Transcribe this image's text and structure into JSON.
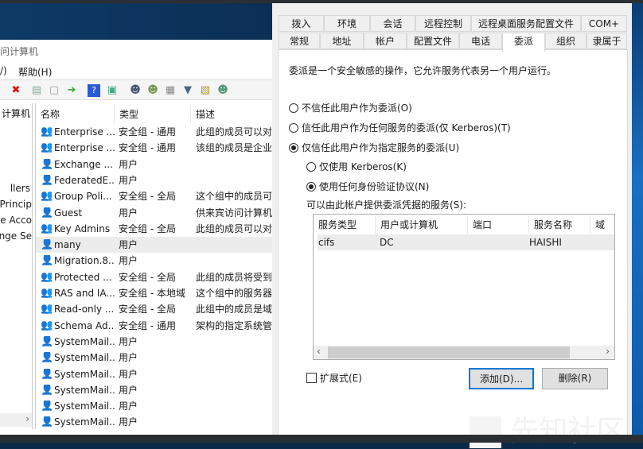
{
  "left_window": {
    "title": "问计算机",
    "menu": [
      "/)",
      "帮助(H)"
    ],
    "toolbar_icons": [
      "delete-icon",
      "properties-icon",
      "refresh-icon",
      "export-icon",
      "help-icon",
      "console-icon",
      "new-user-icon",
      "new-group-icon",
      "new-ou-icon",
      "filter-icon",
      "find-icon",
      "add-to-group-icon"
    ],
    "tree_header": "计算机",
    "tree_items": [
      "llers",
      "Princip",
      "ce Acco",
      "ange Se"
    ],
    "columns": [
      "名称",
      "类型",
      "描述"
    ],
    "rows": [
      {
        "name": "Enterprise ...",
        "type": "安全组 - 通用",
        "desc": "此组的成员可以对",
        "icon": "group"
      },
      {
        "name": "Enterprise ...",
        "type": "安全组 - 通用",
        "desc": "该组的成员是企业",
        "icon": "group"
      },
      {
        "name": "Exchange ...",
        "type": "用户",
        "desc": "",
        "icon": "disabled-user"
      },
      {
        "name": "FederatedE...",
        "type": "用户",
        "desc": "",
        "icon": "disabled-user"
      },
      {
        "name": "Group Poli...",
        "type": "安全组 - 全局",
        "desc": "这个组中的成员可",
        "icon": "group"
      },
      {
        "name": "Guest",
        "type": "用户",
        "desc": "供来宾访问计算机",
        "icon": "disabled-user"
      },
      {
        "name": "Key Admins",
        "type": "安全组 - 全局",
        "desc": "此组的成员可以对",
        "icon": "group"
      },
      {
        "name": "many",
        "type": "用户",
        "desc": "",
        "icon": "user",
        "selected": true
      },
      {
        "name": "Migration.8...",
        "type": "用户",
        "desc": "",
        "icon": "disabled-user"
      },
      {
        "name": "Protected ...",
        "type": "安全组 - 全局",
        "desc": "此组的成员将受到",
        "icon": "group"
      },
      {
        "name": "RAS and IA...",
        "type": "安全组 - 本地域",
        "desc": "这个组中的服务器",
        "icon": "group"
      },
      {
        "name": "Read-only ...",
        "type": "安全组 - 全局",
        "desc": "此组中的成员是域",
        "icon": "group"
      },
      {
        "name": "Schema Ad...",
        "type": "安全组 - 通用",
        "desc": "架构的指定系统管",
        "icon": "group"
      },
      {
        "name": "SystemMail...",
        "type": "用户",
        "desc": "",
        "icon": "disabled-user"
      },
      {
        "name": "SystemMail...",
        "type": "用户",
        "desc": "",
        "icon": "disabled-user"
      },
      {
        "name": "SystemMail...",
        "type": "用户",
        "desc": "",
        "icon": "disabled-user"
      },
      {
        "name": "SystemMail...",
        "type": "用户",
        "desc": "",
        "icon": "disabled-user"
      },
      {
        "name": "SystemMail...",
        "type": "用户",
        "desc": "",
        "icon": "disabled-user"
      },
      {
        "name": "SystemMail...",
        "type": "用户",
        "desc": "",
        "icon": "disabled-user"
      }
    ]
  },
  "dialog": {
    "tabs_row1": [
      "拨入",
      "环境",
      "会话",
      "远程控制",
      "远程桌面服务配置文件",
      "COM+"
    ],
    "tabs_row2": [
      "常规",
      "地址",
      "帐户",
      "配置文件",
      "电话",
      "委派",
      "组织",
      "隶属于"
    ],
    "active_tab": "委派",
    "description": "委派是一个安全敏感的操作，它允许服务代表另一个用户运行。",
    "radios": [
      {
        "label": "不信任此用户作为委派(O)",
        "checked": false
      },
      {
        "label": "信任此用户作为任何服务的委派(仅 Kerberos)(T)",
        "checked": false
      },
      {
        "label": "仅信任此用户作为指定服务的委派(U)",
        "checked": true
      }
    ],
    "sub_radios": [
      {
        "label": "仅使用 Kerberos(K)",
        "checked": false
      },
      {
        "label": "使用任何身份验证协议(N)",
        "checked": true
      }
    ],
    "services_label": "可以由此帐户提供委派凭据的服务(S):",
    "services_columns": [
      "服务类型",
      "用户或计算机",
      "端口",
      "服务名称",
      "域"
    ],
    "services_rows": [
      [
        "cifs",
        "DC",
        "",
        "HAISHI",
        ""
      ]
    ],
    "expanded_label": "扩展式(E)",
    "expanded_checked": false,
    "add_button": "添加(D)...",
    "remove_button": "删除(R)"
  },
  "watermark": "先知社区"
}
